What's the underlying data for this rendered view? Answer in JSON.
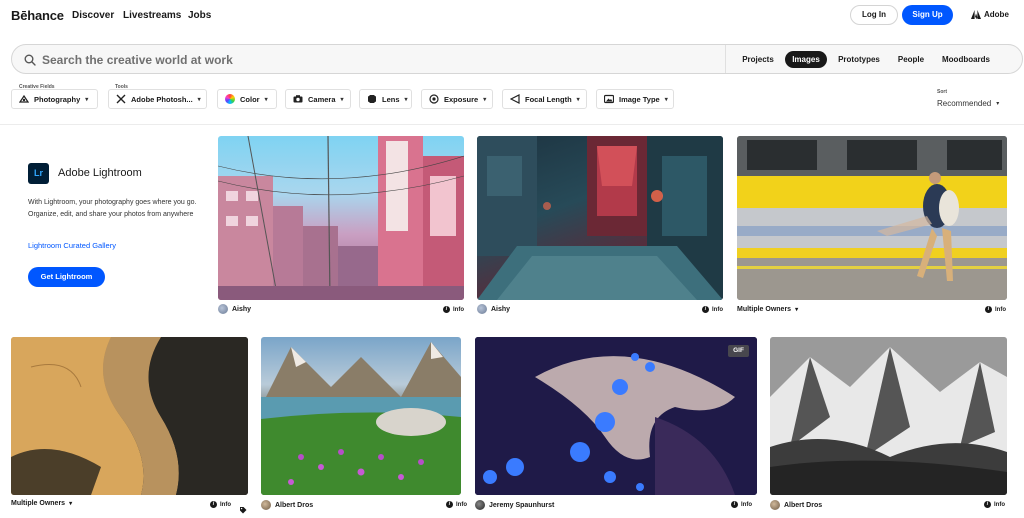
{
  "nav": {
    "logo": "Bēhance",
    "links": [
      "Discover",
      "Livestreams",
      "Jobs"
    ],
    "login": "Log In",
    "signup": "Sign Up",
    "adobe": "Adobe"
  },
  "search": {
    "placeholder": "Search the creative world at work",
    "tabs": [
      "Projects",
      "Images",
      "Prototypes",
      "People",
      "Moodboards"
    ],
    "active_tab": "Images"
  },
  "filters": {
    "creative_fields_label": "Creative Fields",
    "tools_label": "Tools",
    "chips": [
      "Photography",
      "Adobe Photosh...",
      "Color",
      "Camera",
      "Lens",
      "Exposure",
      "Focal Length",
      "Image Type"
    ],
    "sort_label": "Sort",
    "sort_value": "Recommended"
  },
  "promo": {
    "icon": "Lr",
    "title": "Adobe Lightroom",
    "description": "With Lightroom, your photography goes where you go. Organize, edit, and share your photos from anywhere",
    "link": "Lightroom Curated Gallery",
    "button": "Get Lightroom"
  },
  "cards": [
    {
      "owner": "Aishy",
      "info": "Info"
    },
    {
      "owner": "Aishy",
      "info": "Info"
    },
    {
      "owner": "Multiple Owners",
      "info": "Info"
    },
    {
      "owner": "Multiple Owners",
      "info": "Info"
    },
    {
      "owner": "Albert Dros",
      "info": "Info"
    },
    {
      "owner": "Jeremy Spaunhurst",
      "info": "Info",
      "badge": "GIF"
    },
    {
      "owner": "Albert Dros",
      "info": "Info"
    }
  ],
  "colors": {
    "brand_blue": "#0057ff",
    "lightroom_bg": "#001e36",
    "lightroom_fg": "#31a8ff"
  }
}
